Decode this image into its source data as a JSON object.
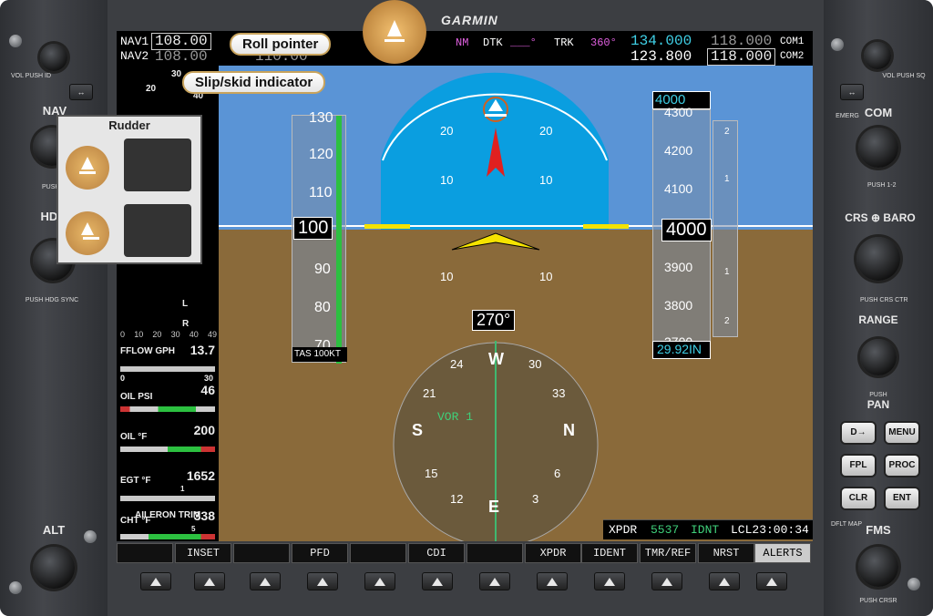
{
  "brand": "GARMIN",
  "callouts": {
    "roll_pointer": "Roll pointer",
    "slip_skid": "Slip/skid indicator"
  },
  "rudder": {
    "title": "Rudder"
  },
  "nav": {
    "nav1_label": "NAV1",
    "nav1_active": "108.00",
    "nav2_label": "NAV2",
    "nav2_active": "108.00",
    "nav2_standby": "110.00"
  },
  "route": {
    "nm": "NM",
    "dtk_label": "DTK",
    "dtk_value": "___°",
    "trk_label": "TRK",
    "trk_value": "360°"
  },
  "com": {
    "com1_label": "COM1",
    "com1_standby": "134.000",
    "com1_active": "118.000",
    "com2_label": "COM2",
    "com2_standby": "123.800",
    "com2_active": "118.000"
  },
  "left_panel": {
    "vol_push_id": "VOL PUSH ID",
    "nav": "NAV",
    "push_12": "PUSH 1-2",
    "hdg": "HDG",
    "push_hdg_sync": "PUSH HDG SYNC",
    "alt": "ALT"
  },
  "right_panel": {
    "vol_push_sq": "VOL PUSH SQ",
    "emerg": "EMERG",
    "com": "COM",
    "push_12": "PUSH 1-2",
    "crs_baro": "CRS ⊕ BARO",
    "push_crs_ctr": "PUSH CRS CTR",
    "range": "RANGE",
    "push": "PUSH",
    "pan": "PAN",
    "dflt_map": "DFLT MAP",
    "fms": "FMS",
    "push_crsr": "PUSH CRSR"
  },
  "fkeys": [
    "D→",
    "MENU",
    "FPL",
    "PROC",
    "CLR",
    "ENT"
  ],
  "airspeed": {
    "ticks": [
      "130",
      "120",
      "110",
      "100",
      "90",
      "80",
      "70"
    ],
    "current": "100",
    "tas": "TAS  100KT"
  },
  "altitude": {
    "selected": "4000",
    "ticks": [
      "4300",
      "4200",
      "4100",
      "4000",
      "3900",
      "3800",
      "3700"
    ],
    "current": "4000",
    "baro": "29.92IN"
  },
  "vsi": {
    "ticks": [
      "2",
      "1",
      "1",
      "2"
    ]
  },
  "attitude": {
    "pitch_up": [
      "20",
      "20",
      "10",
      "10"
    ],
    "pitch_down": [
      "10",
      "10"
    ]
  },
  "hsi": {
    "heading": "270°",
    "source": "VOR 1",
    "cardinal": [
      "W",
      "N",
      "E",
      "S"
    ],
    "numbers": [
      "24",
      "33",
      "30",
      "6",
      "12",
      "15",
      "21",
      "3"
    ]
  },
  "eis": {
    "rpm_ticks": [
      "20",
      "30",
      "40"
    ],
    "fuel_scale": [
      "0",
      "10",
      "20",
      "30",
      "40",
      "49"
    ],
    "fuel_l": "L",
    "fuel_r": "R",
    "fflow_label": "FFLOW GPH",
    "fflow_value": "13.7",
    "fflow_min": "0",
    "fflow_max": "30",
    "oil_psi_label": "OIL PSI",
    "oil_psi_value": "46",
    "oil_f_label": "OIL °F",
    "oil_f_value": "200",
    "egt_label": "EGT °F",
    "egt_value": "1652",
    "egt_cyl": "1",
    "cht_label": "CHT °F",
    "cht_value": "338",
    "cht_cyl": "5",
    "aileron_label": "AILERON TRIM"
  },
  "status": {
    "xpdr": "XPDR",
    "code": "5537",
    "mode": "IDNT",
    "lcl": "LCL23:00:34"
  },
  "softkeys": [
    "",
    "INSET",
    "",
    "PFD",
    "",
    "CDI",
    "",
    "XPDR",
    "IDENT",
    "TMR/REF",
    "NRST",
    "ALERTS"
  ]
}
